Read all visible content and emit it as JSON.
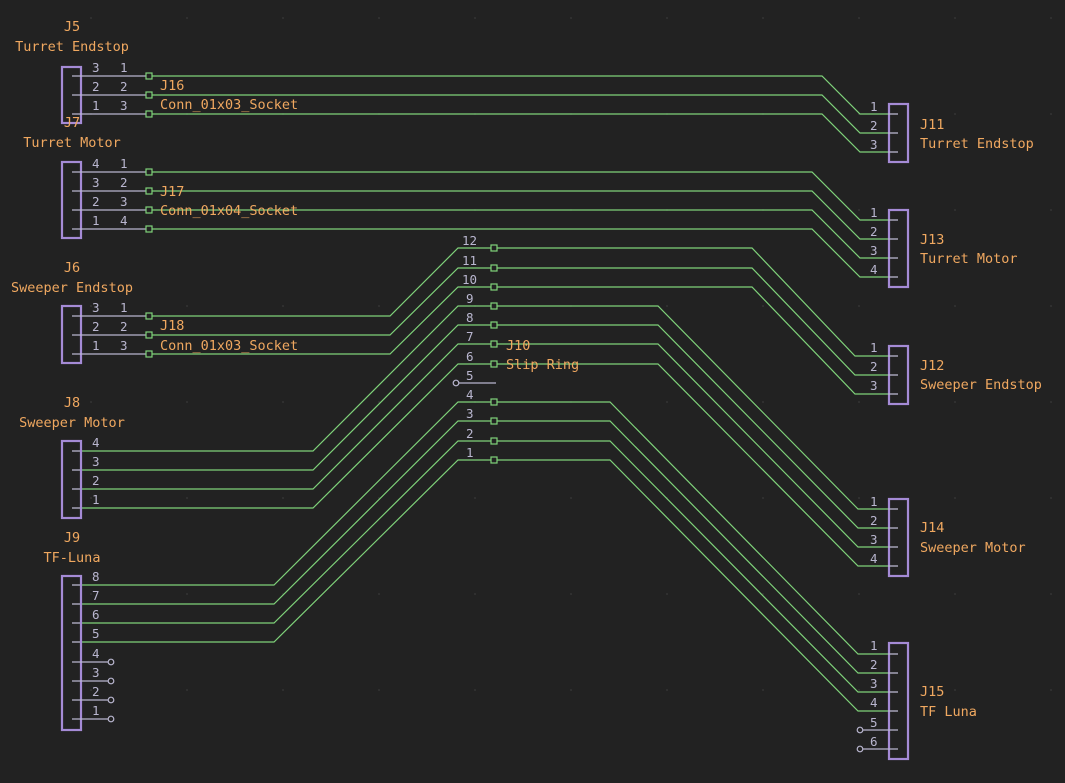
{
  "schematic": {
    "theme": {
      "background": "#222222",
      "wire": "#7fd27a",
      "body": "#a58bd6",
      "pin": "#b9b6cf",
      "label": "#f0a860"
    },
    "connectors": [
      {
        "id": "j5",
        "ref": "J5",
        "value": "Turret Endstop",
        "side": "left",
        "pins": [
          "3",
          "2",
          "1"
        ]
      },
      {
        "id": "j16",
        "ref": "J16",
        "value": "Conn_01x03_Socket",
        "side": "socket",
        "pins": [
          "1",
          "2",
          "3"
        ]
      },
      {
        "id": "j7",
        "ref": "J7",
        "value": "Turret Motor",
        "side": "left",
        "pins": [
          "4",
          "3",
          "2",
          "1"
        ]
      },
      {
        "id": "j17",
        "ref": "J17",
        "value": "Conn_01x04_Socket",
        "side": "socket",
        "pins": [
          "1",
          "2",
          "3",
          "4"
        ]
      },
      {
        "id": "j6",
        "ref": "J6",
        "value": "Sweeper Endstop",
        "side": "left",
        "pins": [
          "3",
          "2",
          "1"
        ]
      },
      {
        "id": "j18",
        "ref": "J18",
        "value": "Conn_01x03_Socket",
        "side": "socket",
        "pins": [
          "1",
          "2",
          "3"
        ]
      },
      {
        "id": "j8",
        "ref": "J8",
        "value": "Sweeper Motor",
        "side": "left",
        "pins": [
          "4",
          "3",
          "2",
          "1"
        ]
      },
      {
        "id": "j9",
        "ref": "J9",
        "value": "TF-Luna",
        "side": "left",
        "pins": [
          "8",
          "7",
          "6",
          "5",
          "4",
          "3",
          "2",
          "1"
        ]
      },
      {
        "id": "j10",
        "ref": "J10",
        "value": "Slip Ring",
        "side": "middle",
        "pins": [
          "12",
          "11",
          "10",
          "9",
          "8",
          "7",
          "6",
          "5",
          "4",
          "3",
          "2",
          "1"
        ]
      },
      {
        "id": "j11",
        "ref": "J11",
        "value": "Turret Endstop",
        "side": "right",
        "pins": [
          "1",
          "2",
          "3"
        ]
      },
      {
        "id": "j13",
        "ref": "J13",
        "value": "Turret Motor",
        "side": "right",
        "pins": [
          "1",
          "2",
          "3",
          "4"
        ]
      },
      {
        "id": "j12",
        "ref": "J12",
        "value": "Sweeper Endstop",
        "side": "right",
        "pins": [
          "1",
          "2",
          "3"
        ]
      },
      {
        "id": "j14",
        "ref": "J14",
        "value": "Sweeper Motor",
        "side": "right",
        "pins": [
          "1",
          "2",
          "3",
          "4"
        ]
      },
      {
        "id": "j15",
        "ref": "J15",
        "value": "TF Luna",
        "side": "right",
        "pins": [
          "1",
          "2",
          "3",
          "4",
          "5",
          "6"
        ]
      }
    ]
  }
}
